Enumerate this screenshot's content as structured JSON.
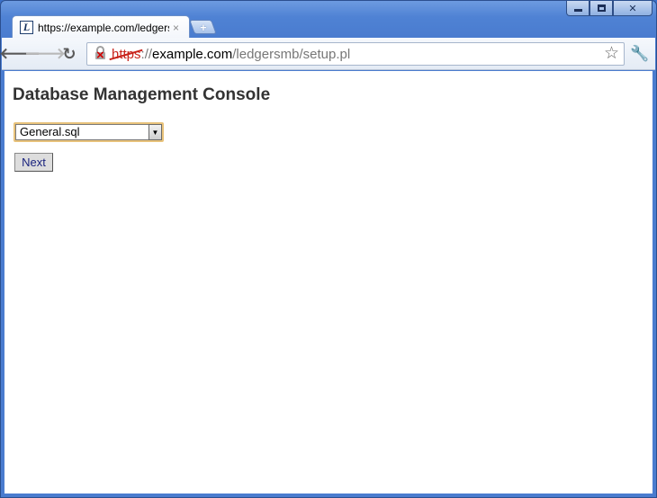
{
  "browser": {
    "tab_title": "https://example.com/ledgersmb/setup.pl",
    "tab_close": "×",
    "new_tab": "+",
    "favicon_letter": "L",
    "url": {
      "scheme": "https",
      "separator": "://",
      "host": "example.com",
      "path": "/ledgersmb/setup.pl"
    }
  },
  "page": {
    "title": "Database Management Console",
    "select": {
      "selected": "General.sql"
    },
    "next_button": "Next"
  },
  "icons": {
    "back": "back-arrow-icon",
    "forward": "forward-arrow-icon",
    "reload": "reload-icon",
    "security": "broken-lock-icon",
    "bookmark": "star-icon",
    "menu": "wrench-icon"
  },
  "colors": {
    "frame": "#4f82d4",
    "select_focus": "#e8c27a",
    "url_error": "#c8231b",
    "button_text": "#1a237e"
  }
}
